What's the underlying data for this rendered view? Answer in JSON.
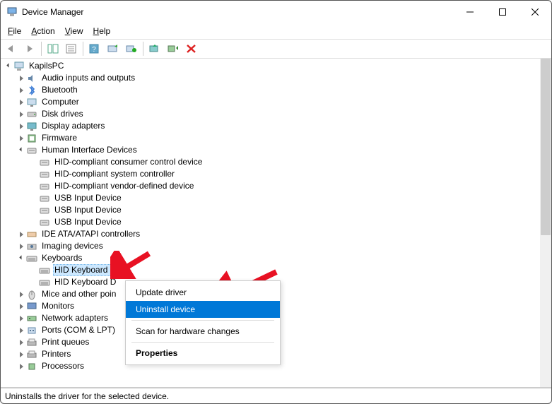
{
  "window": {
    "title": "Device Manager"
  },
  "menu": {
    "file": "File",
    "action": "Action",
    "view": "View",
    "help": "Help"
  },
  "tree": {
    "root": "KapilsPC",
    "items": [
      {
        "label": "Audio inputs and outputs",
        "expanded": false
      },
      {
        "label": "Bluetooth",
        "expanded": false
      },
      {
        "label": "Computer",
        "expanded": false
      },
      {
        "label": "Disk drives",
        "expanded": false
      },
      {
        "label": "Display adapters",
        "expanded": false
      },
      {
        "label": "Firmware",
        "expanded": false
      },
      {
        "label": "Human Interface Devices",
        "expanded": true,
        "children": [
          "HID-compliant consumer control device",
          "HID-compliant system controller",
          "HID-compliant vendor-defined device",
          "USB Input Device",
          "USB Input Device",
          "USB Input Device"
        ]
      },
      {
        "label": "IDE ATA/ATAPI controllers",
        "expanded": false
      },
      {
        "label": "Imaging devices",
        "expanded": false
      },
      {
        "label": "Keyboards",
        "expanded": true,
        "children": [
          "HID Keyboard Device",
          "HID Keyboard Device"
        ],
        "selected_child": 0
      },
      {
        "label": "Mice and other pointing devices",
        "expanded": false,
        "truncated": "Mice and other poin"
      },
      {
        "label": "Monitors",
        "expanded": false
      },
      {
        "label": "Network adapters",
        "expanded": false
      },
      {
        "label": "Ports (COM & LPT)",
        "expanded": false
      },
      {
        "label": "Print queues",
        "expanded": false
      },
      {
        "label": "Printers",
        "expanded": false
      },
      {
        "label": "Processors",
        "expanded": false
      }
    ]
  },
  "context_menu": {
    "update": "Update driver",
    "uninstall": "Uninstall device",
    "scan": "Scan for hardware changes",
    "properties": "Properties"
  },
  "status": "Uninstalls the driver for the selected device."
}
